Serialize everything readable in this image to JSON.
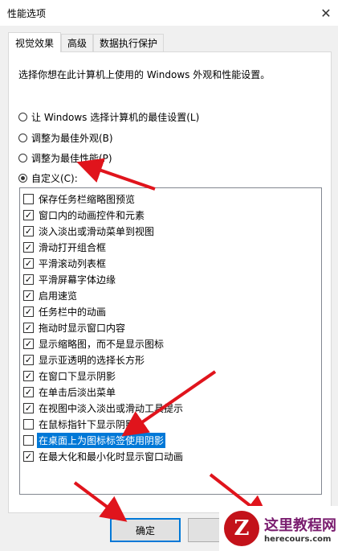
{
  "window": {
    "title": "性能选项"
  },
  "tabs": [
    {
      "label": "视觉效果",
      "active": true
    },
    {
      "label": "高级",
      "active": false
    },
    {
      "label": "数据执行保护",
      "active": false
    }
  ],
  "description": "选择你想在此计算机上使用的 Windows 外观和性能设置。",
  "radios": [
    {
      "label": "让 Windows 选择计算机的最佳设置(L)",
      "checked": false
    },
    {
      "label": "调整为最佳外观(B)",
      "checked": false
    },
    {
      "label": "调整为最佳性能(P)",
      "checked": false
    },
    {
      "label": "自定义(C):",
      "checked": true
    }
  ],
  "options": [
    {
      "label": "保存任务栏缩略图预览",
      "checked": false
    },
    {
      "label": "窗口内的动画控件和元素",
      "checked": true
    },
    {
      "label": "淡入淡出或滑动菜单到视图",
      "checked": true
    },
    {
      "label": "滑动打开组合框",
      "checked": true
    },
    {
      "label": "平滑滚动列表框",
      "checked": true
    },
    {
      "label": "平滑屏幕字体边缘",
      "checked": true
    },
    {
      "label": "启用速览",
      "checked": true
    },
    {
      "label": "任务栏中的动画",
      "checked": true
    },
    {
      "label": "拖动时显示窗口内容",
      "checked": true
    },
    {
      "label": "显示缩略图，而不是显示图标",
      "checked": true
    },
    {
      "label": "显示亚透明的选择长方形",
      "checked": true
    },
    {
      "label": "在窗口下显示阴影",
      "checked": true
    },
    {
      "label": "在单击后淡出菜单",
      "checked": true
    },
    {
      "label": "在视图中淡入淡出或滑动工具提示",
      "checked": true
    },
    {
      "label": "在鼠标指针下显示阴影",
      "checked": false
    },
    {
      "label": "在桌面上为图标标签使用阴影",
      "checked": false,
      "selected": true
    },
    {
      "label": "在最大化和最小化时显示窗口动画",
      "checked": true
    }
  ],
  "buttons": {
    "ok": "确定"
  },
  "watermark": {
    "cn": "这里教程网",
    "en": "herecours.com",
    "mark": "Z"
  },
  "colors": {
    "arrow": "#e0141c",
    "selection": "#0078d7"
  }
}
